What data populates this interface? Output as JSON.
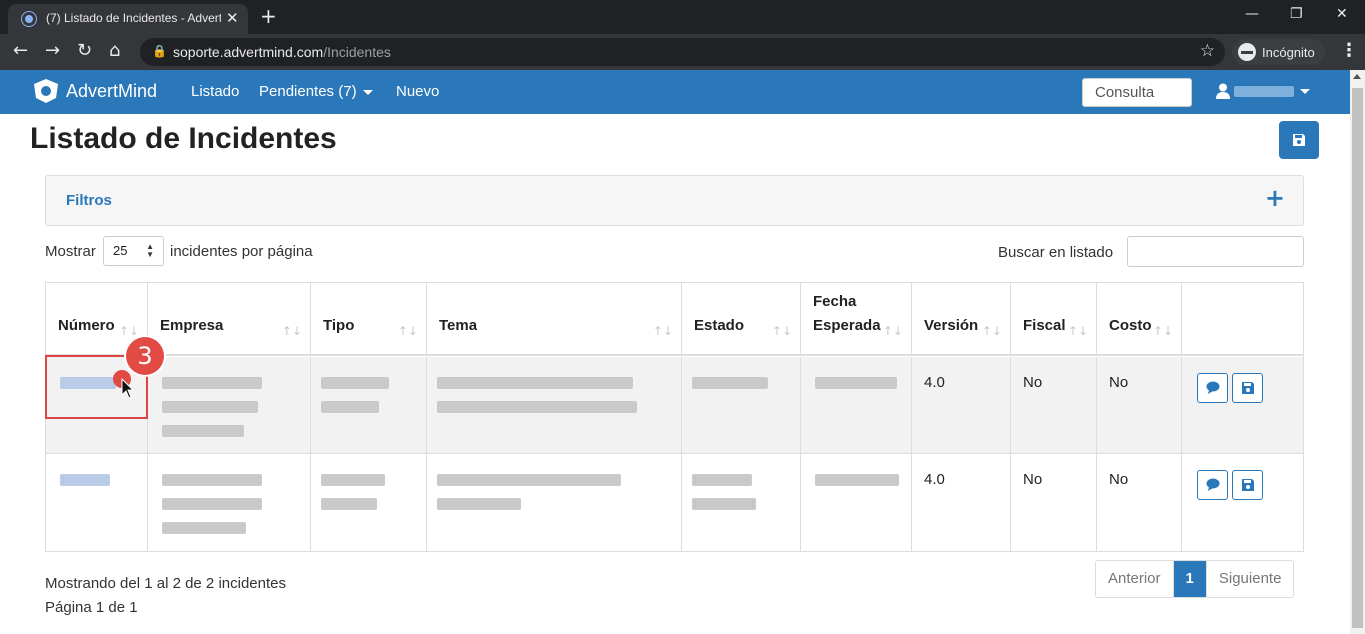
{
  "browser": {
    "tab_title": "(7) Listado de Incidentes - Advert",
    "url_domain": "soporte.advertmind.com",
    "url_path": "/Incidentes",
    "incognito_label": "Incógnito"
  },
  "navbar": {
    "brand": "AdvertMind",
    "links": [
      "Listado",
      "Pendientes (7)",
      "Nuevo"
    ],
    "search_button": "Consulta"
  },
  "page": {
    "title": "Listado de Incidentes",
    "filters_label": "Filtros",
    "show_label": "Mostrar",
    "page_size": "25",
    "per_page_label": "incidentes por página",
    "search_label": "Buscar en listado"
  },
  "table": {
    "headers": [
      "Número",
      "Empresa",
      "Tipo",
      "Tema",
      "Estado",
      "Fecha Esperada",
      "Versión",
      "Fiscal",
      "Costo"
    ],
    "rows": [
      {
        "version": "4.0",
        "fiscal": "No",
        "costo": "No"
      },
      {
        "version": "4.0",
        "fiscal": "No",
        "costo": "No"
      }
    ]
  },
  "annotation": {
    "step_number": "3"
  },
  "footer": {
    "showing": "Mostrando del 1 al 2 de 2 incidentes",
    "page_info": "Página 1 de 1",
    "prev": "Anterior",
    "current_page": "1",
    "next": "Siguiente"
  },
  "colors": {
    "primary": "#2a78b9",
    "annotation": "#e24a44"
  }
}
